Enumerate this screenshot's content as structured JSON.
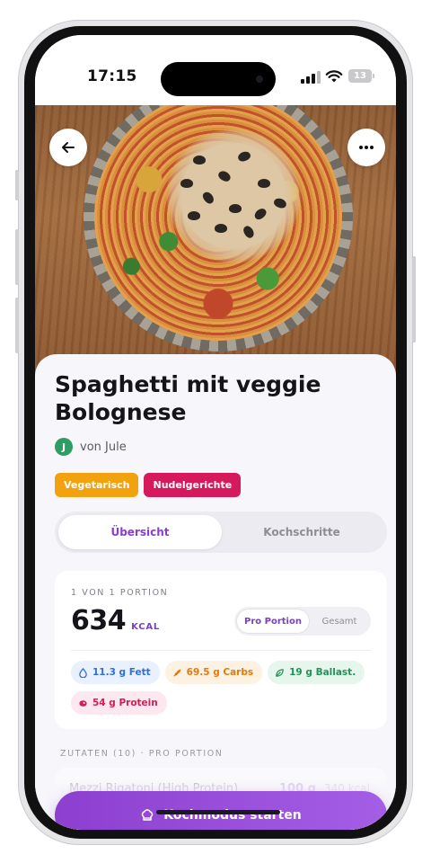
{
  "status_bar": {
    "time": "17:15",
    "battery": "13"
  },
  "recipe": {
    "title": "Spaghetti mit veggie Bolognese",
    "author_initial": "J",
    "author": "von Jule",
    "tags": [
      {
        "label": "Vegetarisch",
        "color": "#f2a20f"
      },
      {
        "label": "Nudelgerichte",
        "color": "#d6195a"
      }
    ]
  },
  "tabs": [
    "Übersicht",
    "Kochschritte"
  ],
  "nutrition": {
    "portion_label": "1 VON 1 PORTION",
    "kcal_value": "634",
    "kcal_unit": "KCAL",
    "toggle": [
      "Pro Portion",
      "Gesamt"
    ],
    "macros": [
      {
        "label": "11.3 g Fett",
        "icon": "drop-icon",
        "bg": "#e8f1fd",
        "fg": "#2f6fd6"
      },
      {
        "label": "69.5 g Carbs",
        "icon": "wheat-icon",
        "bg": "#fdf1e2",
        "fg": "#e07b12"
      },
      {
        "label": "19 g Ballast.",
        "icon": "leaf-icon",
        "bg": "#e6f6ec",
        "fg": "#23925a"
      },
      {
        "label": "54 g Protein",
        "icon": "meat-icon",
        "bg": "#fde8ef",
        "fg": "#d11e55"
      }
    ]
  },
  "ingredients": {
    "section_label": "ZUTATEN (10) · PRO PORTION",
    "first_item": {
      "name": "Mezzi Rigatoni (High Protein)",
      "qty": "100 g",
      "kcal": "340 kcal"
    }
  },
  "cta": {
    "label": "Kochmodus starten",
    "icon": "chef-hat-icon"
  },
  "colors": {
    "accent": "#8a3ed0"
  }
}
